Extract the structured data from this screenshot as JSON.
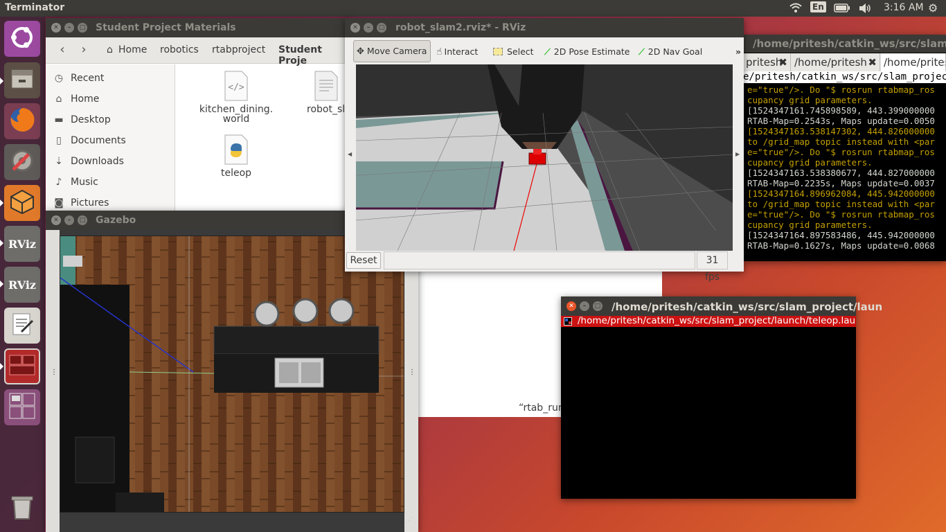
{
  "topbar": {
    "app_name": "Terminator",
    "keyboard": "En",
    "time": "3:16 AM"
  },
  "launcher": {
    "items": [
      {
        "name": "ubuntu-dash"
      },
      {
        "name": "files"
      },
      {
        "name": "firefox"
      },
      {
        "name": "system-settings"
      },
      {
        "name": "gazebo"
      },
      {
        "name": "rviz-1",
        "label": "RViz"
      },
      {
        "name": "rviz-2",
        "label": "RViz"
      },
      {
        "name": "text-editor"
      },
      {
        "name": "terminator"
      },
      {
        "name": "workspace-switcher"
      },
      {
        "name": "trash"
      }
    ]
  },
  "files_window": {
    "title": "Student Project Materials",
    "breadcrumbs": [
      "Home",
      "robotics",
      "rtabproject",
      "Student Proje"
    ],
    "sidebar": [
      "Recent",
      "Home",
      "Desktop",
      "Documents",
      "Downloads",
      "Music",
      "Pictures"
    ],
    "files": [
      {
        "name_line1": "kitchen_dining.",
        "name_line2": "world",
        "type": "xml-file-icon"
      },
      {
        "name_line1": "robot_sl",
        "name_line2": "",
        "type": "text-file-icon"
      },
      {
        "name_line1": "teleop",
        "name_line2": "",
        "type": "python-file-icon"
      }
    ]
  },
  "rviz_window": {
    "title": "robot_slam2.rviz* - RViz",
    "tools": [
      "Move Camera",
      "Interact",
      "Select",
      "2D Pose Estimate",
      "2D Nav Goal"
    ],
    "overflow": "»",
    "reset_label": "Reset",
    "fps": "31 fps"
  },
  "gazebo_window": {
    "title": "Gazebo"
  },
  "white_window": {
    "text": "“rtab_run"
  },
  "terminal_right": {
    "title": "/home/pritesh/catkin_ws/src/slam_",
    "tabs": [
      "pritesh",
      "/home/pritesh",
      "/home/prites"
    ],
    "path_line": "e/pritesh/catkin_ws/src/slam_project/launch/r",
    "lines": [
      "e=\"true\"/>. Do \"$ rosrun rtabmap_ros",
      "cupancy grid parameters.",
      "[1524347161.745898589, 443.399000000",
      "RTAB-Map=0.2543s, Maps update=0.0050",
      "[1524347163.538147302, 444.826000000",
      "to /grid_map topic instead with <par",
      "e=\"true\"/>. Do \"$ rosrun rtabmap_ros",
      "cupancy grid parameters.",
      "[1524347163.538380677, 444.827000000",
      "RTAB-Map=0.2235s, Maps update=0.0037",
      "[1524347164.896962084, 445.942000000",
      "to /grid_map topic instead with <par",
      "e=\"true\"/>. Do \"$ rosrun rtabmap_ros",
      "cupancy grid parameters.",
      "[1524347164.897583486, 445.942000000",
      "RTAB-Map=0.1627s, Maps update=0.0068"
    ],
    "colors": {
      "warn": "#c4a000",
      "info": "#d3d7cf"
    }
  },
  "terminal_teleop": {
    "title": "/home/pritesh/catkin_ws/src/slam_project/laun",
    "header": "/home/pritesh/catkin_ws/src/slam_project/launch/teleop.launc"
  }
}
